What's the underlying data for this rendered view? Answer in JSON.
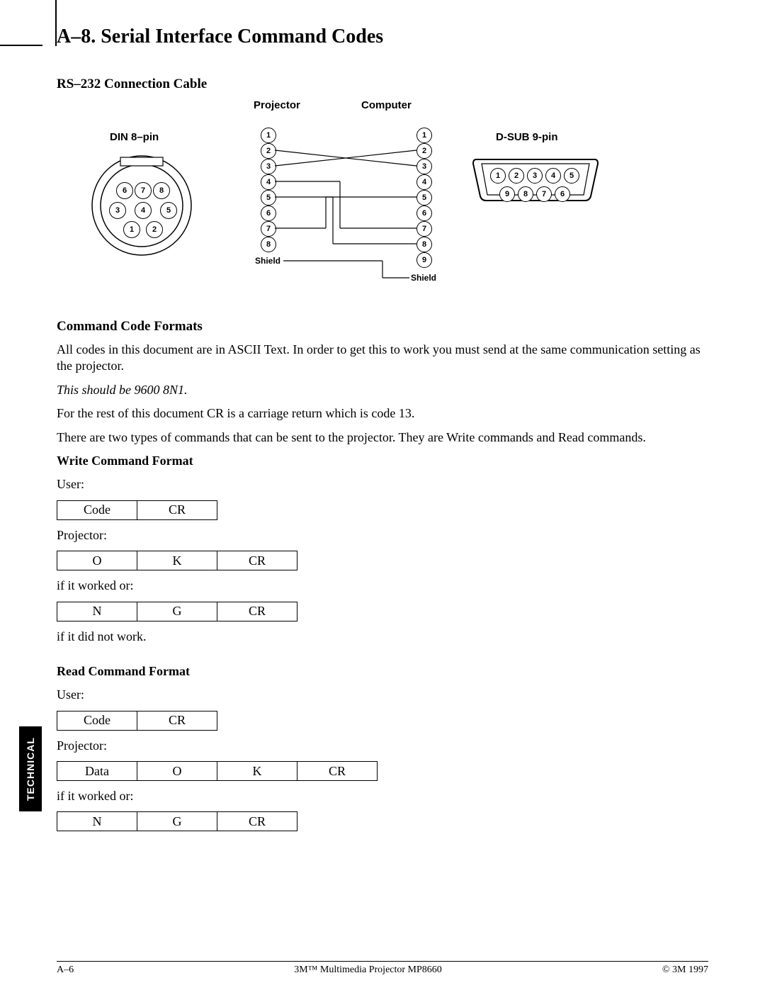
{
  "section": {
    "title": "A–8.  Serial Interface Command Codes",
    "sub1": "RS–232 Connection Cable",
    "sub2": "Command Code Formats",
    "write_hdr": "Write Command Format",
    "read_hdr": "Read Command Format"
  },
  "diagram": {
    "projector_label": "Projector",
    "computer_label": "Computer",
    "din_label": "DIN 8–pin",
    "dsub_label": "D-SUB 9-pin",
    "shield_left": "Shield",
    "shield_right": "Shield",
    "din_pins": [
      "1",
      "2",
      "3",
      "4",
      "5",
      "6",
      "7",
      "8"
    ],
    "dsub_pins_top": [
      "1",
      "2",
      "3",
      "4",
      "5"
    ],
    "dsub_pins_bot": [
      "9",
      "8",
      "7",
      "6"
    ],
    "left_seq": [
      "1",
      "2",
      "3",
      "4",
      "5",
      "6",
      "7",
      "8"
    ],
    "right_seq": [
      "1",
      "2",
      "3",
      "4",
      "5",
      "6",
      "7",
      "8",
      "9"
    ]
  },
  "text": {
    "p1": "All codes in this document are in ASCII Text.  In order to get this to work you must send at the same communication setting as the projector.",
    "p2": "This should be 9600 8N1.",
    "p3": "For the rest of this document CR is a carriage return which is code 13.",
    "p4": "There are two types of commands that can be sent to the projector.  They are Write commands and Read commands.",
    "user": "User:",
    "projector": "Projector:",
    "worked": "if it worked or:",
    "notwork": "if it did not work."
  },
  "tables": {
    "write_user": [
      "Code",
      "CR"
    ],
    "write_ok": [
      "O",
      "K",
      "CR"
    ],
    "write_ng": [
      "N",
      "G",
      "CR"
    ],
    "read_user": [
      "Code",
      "CR"
    ],
    "read_ok": [
      "Data",
      "O",
      "K",
      "CR"
    ],
    "read_ng": [
      "N",
      "G",
      "CR"
    ]
  },
  "sidebar": "TECHNICAL",
  "footer": {
    "left": "A–6",
    "center": "3M™ Multimedia Projector MP8660",
    "right": "© 3M 1997"
  }
}
